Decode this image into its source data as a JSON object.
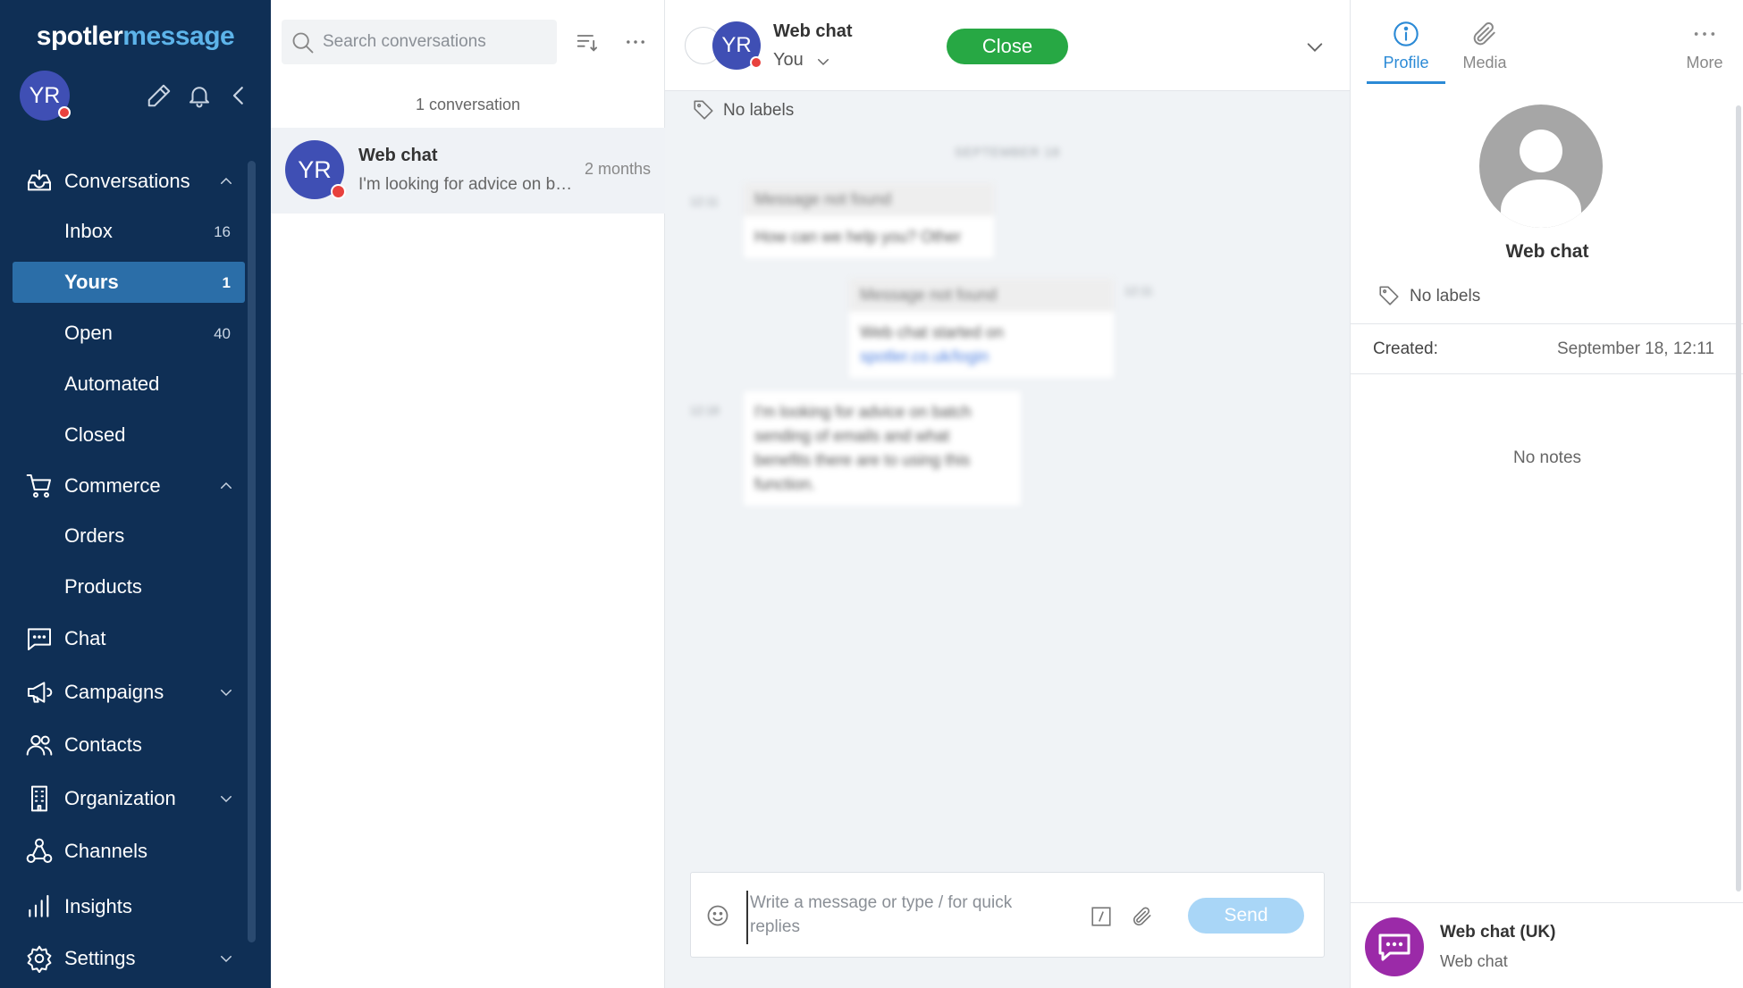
{
  "sidebar": {
    "logo_part1": "spotler",
    "logo_part2": "message",
    "user_initials": "YR",
    "nav": {
      "conversations": "Conversations",
      "inbox": "Inbox",
      "inbox_count": "16",
      "yours": "Yours",
      "yours_count": "1",
      "open": "Open",
      "open_count": "40",
      "automated": "Automated",
      "closed": "Closed",
      "commerce": "Commerce",
      "orders": "Orders",
      "products": "Products",
      "chat": "Chat",
      "campaigns": "Campaigns",
      "contacts": "Contacts",
      "organization": "Organization",
      "channels": "Channels",
      "insights": "Insights",
      "settings": "Settings"
    },
    "colors": {
      "background": "#0f2f55",
      "active": "#2b6ea8",
      "accent": "#5db4ea"
    }
  },
  "conversation_list": {
    "search_placeholder": "Search conversations",
    "count_label": "1 conversation",
    "items": [
      {
        "initials": "YR",
        "name": "Web chat",
        "preview": "I'm looking for advice on batch sending of emails and what benefits there are to using this function.",
        "time": "2 months"
      }
    ]
  },
  "chat": {
    "header": {
      "initials": "YR",
      "title": "Web chat",
      "assignee": "You",
      "close_label": "Close"
    },
    "labels": "No labels",
    "messages": {
      "date_divider": "SEPTEMBER 18",
      "time1": "12:11",
      "msg1_header": "Message not found",
      "msg1_body": "How can we help you? Other",
      "msg2_header": "Message not found",
      "msg2_body": "Web chat started on",
      "msg2_link": "spotler.co.uk/login",
      "time2": "12:11",
      "time3": "12:18",
      "msg3_body": "I'm looking for advice on batch sending of emails and what benefits there are to using this function."
    },
    "composer": {
      "placeholder": "Write a message or type / for quick replies",
      "send_label": "Send"
    }
  },
  "right_panel": {
    "tabs": {
      "profile": "Profile",
      "media": "Media",
      "more": "More"
    },
    "profile_name": "Web chat",
    "labels": "No labels",
    "created_label": "Created:",
    "created_value": "September 18, 12:11",
    "notes_empty": "No notes",
    "channel_name": "Web chat (UK)",
    "channel_type": "Web chat"
  },
  "colors": {
    "close_button": "#27a844",
    "send_button_disabled": "#a9d6f7",
    "status_dot": "#e8413d",
    "avatar": "#3f4fb4",
    "channel_icon": "#9b2aa8",
    "tab_active": "#2b8ad6"
  }
}
